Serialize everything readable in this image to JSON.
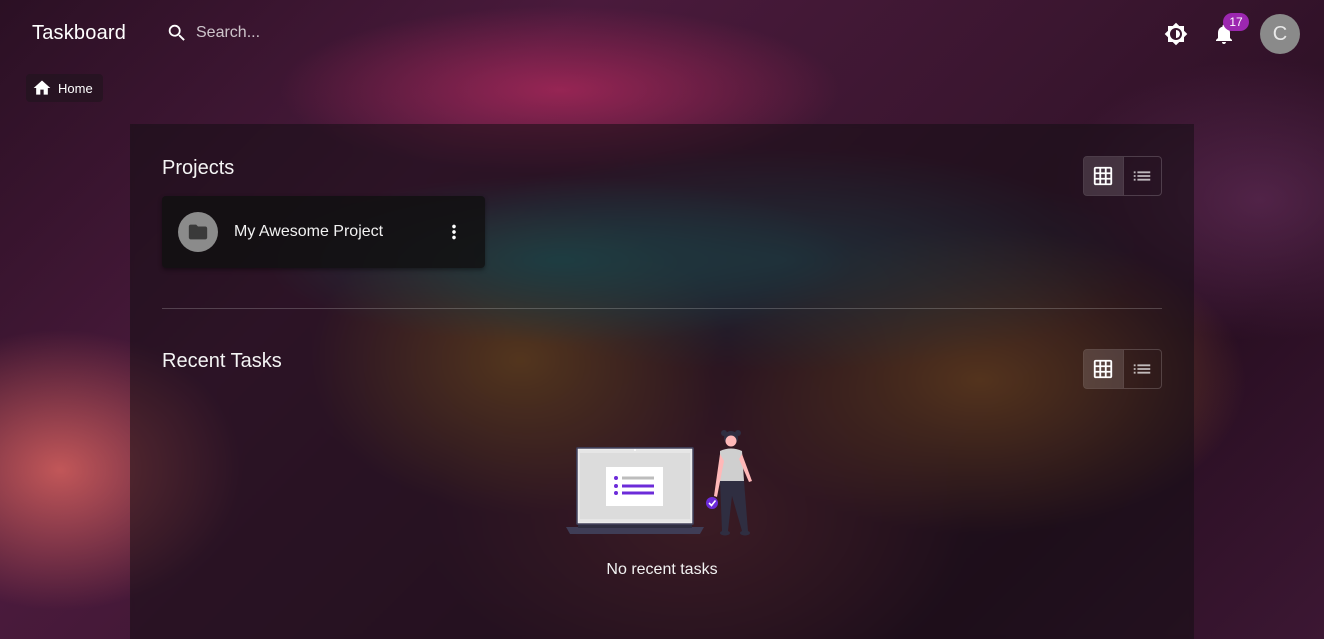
{
  "app": {
    "title": "Taskboard"
  },
  "search": {
    "placeholder": "Search..."
  },
  "header": {
    "notifications_count": "17",
    "avatar_initial": "C",
    "theme_icon": "brightness-icon",
    "notification_icon": "bell-icon"
  },
  "breadcrumb": {
    "home_label": "Home"
  },
  "projects": {
    "title": "Projects",
    "items": [
      {
        "name": "My Awesome Project",
        "icon": "folder-icon"
      }
    ]
  },
  "recent_tasks": {
    "title": "Recent Tasks",
    "empty_message": "No recent tasks"
  },
  "view_toggle": {
    "grid_icon": "grid-view-icon",
    "list_icon": "list-view-icon",
    "selected": "grid"
  },
  "colors": {
    "badge": "#9c27b0",
    "illustration_accent": "#6c2bd9",
    "avatar_bg": "#8a8a8a"
  }
}
